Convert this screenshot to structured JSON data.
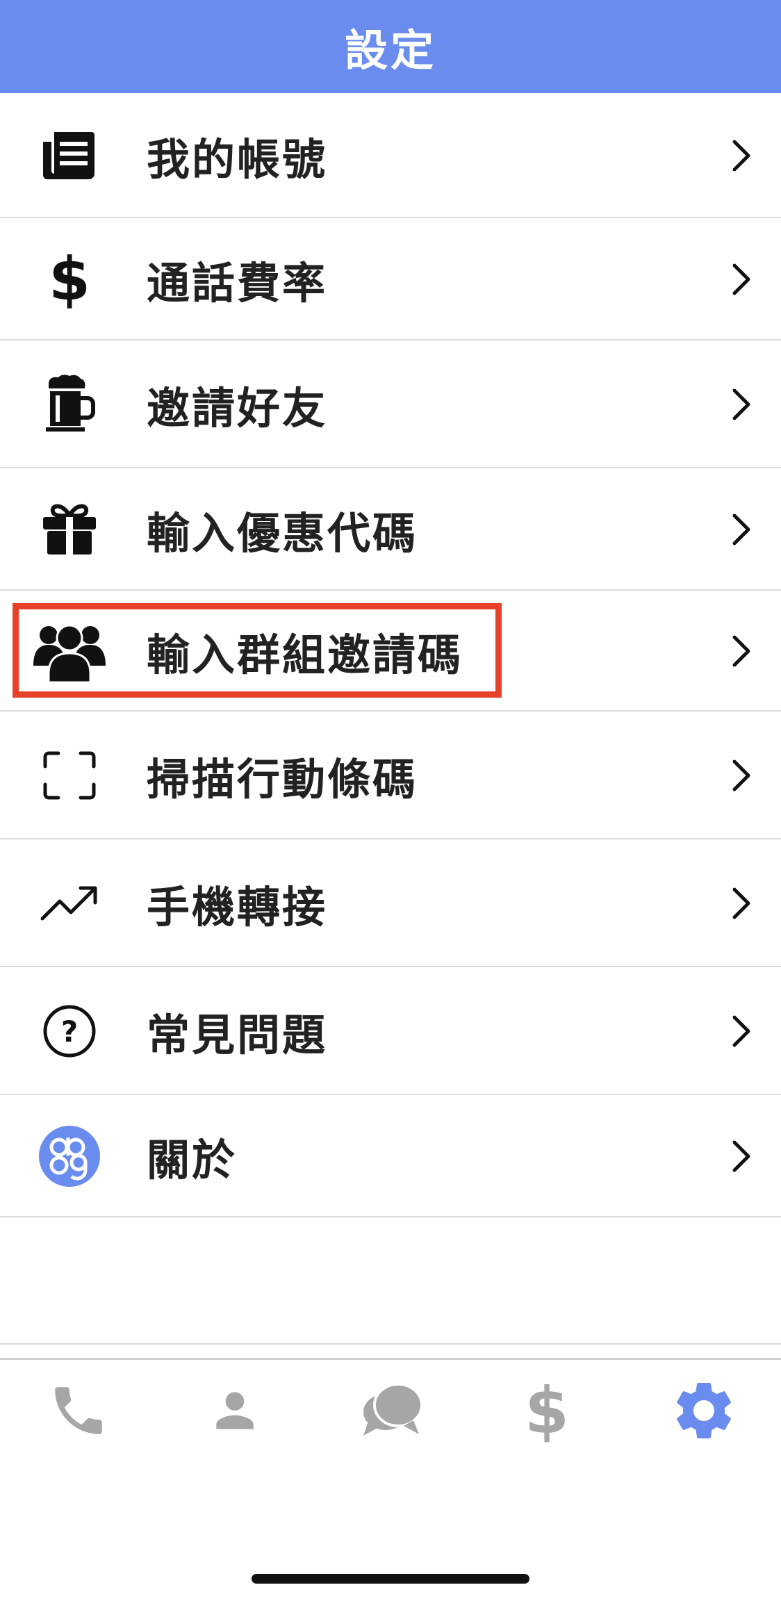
{
  "header": {
    "title": "設定"
  },
  "menu": {
    "items": [
      {
        "label": "我的帳號",
        "icon": "account-list-icon"
      },
      {
        "label": "通話費率",
        "icon": "dollar-icon"
      },
      {
        "label": "邀請好友",
        "icon": "beer-mug-icon"
      },
      {
        "label": "輸入優惠代碼",
        "icon": "gift-icon"
      },
      {
        "label": "輸入群組邀請碼",
        "icon": "group-icon"
      },
      {
        "label": "掃描行動條碼",
        "icon": "scan-frame-icon"
      },
      {
        "label": "手機轉接",
        "icon": "trending-up-icon"
      },
      {
        "label": "常見問題",
        "icon": "help-circle-icon"
      },
      {
        "label": "關於",
        "icon": "app-logo-icon"
      }
    ]
  },
  "tabbar": {
    "tabs": [
      {
        "name": "phone",
        "icon": "phone-icon",
        "active": false
      },
      {
        "name": "contacts",
        "icon": "person-icon",
        "active": false
      },
      {
        "name": "messages",
        "icon": "chat-bubbles-icon",
        "active": false
      },
      {
        "name": "rates",
        "icon": "dollar-icon",
        "active": false
      },
      {
        "name": "settings",
        "icon": "gear-icon",
        "active": true
      }
    ]
  },
  "colors": {
    "header_bg": "#6b8cef",
    "active_tab": "#6b8cef",
    "inactive_tab": "#a6a6a6",
    "highlight": "#e8412a"
  }
}
